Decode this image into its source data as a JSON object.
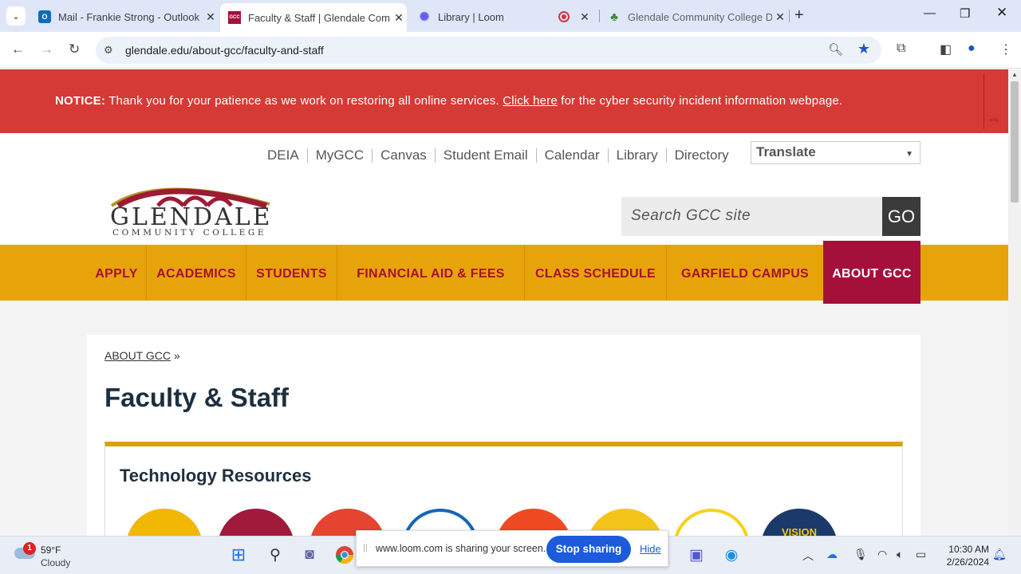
{
  "browser": {
    "tabs": [
      {
        "title": "Mail - Frankie Strong - Outlook",
        "icon": "outlook-icon"
      },
      {
        "title": "Faculty & Staff | Glendale Comm",
        "icon": "gcc-icon",
        "active": true
      },
      {
        "title": "Library | Loom",
        "icon": "loom-icon"
      },
      {
        "title": "",
        "icon": "record-icon"
      },
      {
        "title": "Glendale Community College D",
        "icon": "tree-icon"
      }
    ],
    "url": "glendale.edu/about-gcc/faculty-and-staff",
    "favicon_label": "GCC"
  },
  "notice": {
    "label": "NOTICE:",
    "text": "Thank you for your patience as we work on restoring all online services.",
    "link": "Click here",
    "text_after": "for the cyber security incident information webpage."
  },
  "utility_nav": [
    "DEIA",
    "MyGCC",
    "Canvas",
    "Student Email",
    "Calendar",
    "Library",
    "Directory"
  ],
  "translate_label": "Translate",
  "logo": {
    "word": "GLENDALE",
    "sub": "COMMUNITY COLLEGE"
  },
  "search": {
    "placeholder": "Search GCC site",
    "button": "GO"
  },
  "main_nav": [
    "APPLY",
    "ACADEMICS",
    "STUDENTS",
    "FINANCIAL AID & FEES",
    "CLASS SCHEDULE",
    "GARFIELD CAMPUS",
    "ABOUT GCC"
  ],
  "breadcrumb": {
    "link": "ABOUT GCC",
    "sep": "»"
  },
  "page_title": "Faculty & Staff",
  "section_title": "Technology Resources",
  "resource_icon_text": "VISION",
  "loom": {
    "message": "www.loom.com is sharing your screen.",
    "stop": "Stop sharing",
    "hide": "Hide"
  },
  "taskbar": {
    "weather_temp": "59°F",
    "weather_cond": "Cloudy",
    "weather_badge": "1",
    "time": "10:30 AM",
    "date": "2/26/2024"
  },
  "colors": {
    "notice_red": "#d63a36",
    "nav_gold": "#e6a40a",
    "nav_active": "#a5103b",
    "nav_text": "#a8102f"
  }
}
